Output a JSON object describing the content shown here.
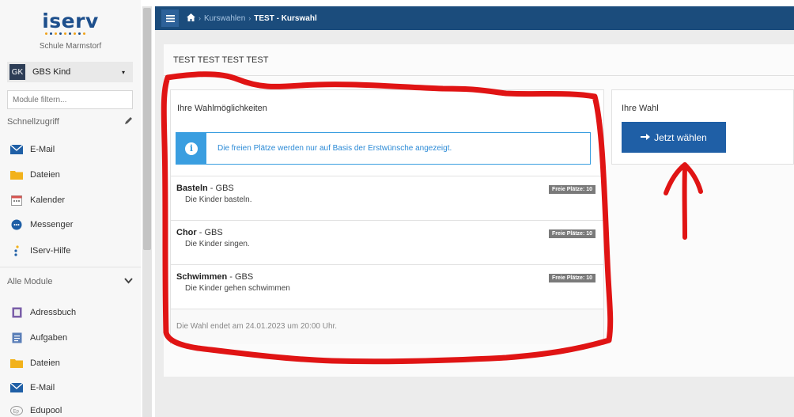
{
  "app": {
    "logo": "iserv",
    "school": "Schule Marmstorf"
  },
  "account": {
    "initials": "GK",
    "name": "GBS Kind",
    "caret": "▾"
  },
  "sidebar": {
    "filter_placeholder": "Module filtern...",
    "quick_access": {
      "label": "Schnellzugriff",
      "edit_icon": "pencil-icon"
    },
    "quick_items": [
      {
        "label": "E-Mail",
        "icon": "envelope-icon"
      },
      {
        "label": "Dateien",
        "icon": "folder-icon"
      },
      {
        "label": "Kalender",
        "icon": "calendar-icon"
      },
      {
        "label": "Messenger",
        "icon": "chat-icon"
      },
      {
        "label": "IServ-Hilfe",
        "icon": "help-icon"
      }
    ],
    "all_modules": {
      "label": "Alle Module",
      "toggle_icon": "chevron-down-icon"
    },
    "module_items": [
      {
        "label": "Adressbuch",
        "icon": "address-book-icon"
      },
      {
        "label": "Aufgaben",
        "icon": "tasks-icon"
      },
      {
        "label": "Dateien",
        "icon": "folder-icon"
      },
      {
        "label": "E-Mail",
        "icon": "envelope-icon"
      },
      {
        "label": "Edupool",
        "icon": "edupool-icon"
      }
    ]
  },
  "breadcrumb": {
    "home_icon": "home-icon",
    "sep": "›",
    "link": "Kurswahlen",
    "current": "TEST - Kurswahl"
  },
  "page": {
    "title": "TEST TEST TEST TEST"
  },
  "choices": {
    "heading": "Ihre Wahlmöglichkeiten",
    "info_text": "Die freien Plätze werden nur auf Basis der Erstwünsche angezeigt.",
    "courses": [
      {
        "name": "Basteln",
        "group": " - GBS",
        "description": "Die Kinder basteln.",
        "badge": "Freie Plätze: 10"
      },
      {
        "name": "Chor",
        "group": " - GBS",
        "description": "Die Kinder singen.",
        "badge": "Freie Plätze: 10"
      },
      {
        "name": "Schwimmen",
        "group": " - GBS",
        "description": "Die Kinder gehen schwimmen",
        "badge": "Freie Plätze: 10"
      }
    ],
    "deadline": "Die Wahl endet am 24.01.2023 um 20:00 Uhr."
  },
  "wahl": {
    "heading": "Ihre Wahl",
    "button_label": "Jetzt wählen",
    "button_icon": "arrow-right-icon"
  },
  "colors": {
    "topbar": "#1b4c7c",
    "primary_button": "#1f5fa6",
    "info": "#3a9ee0",
    "annotation": "#e01414"
  }
}
